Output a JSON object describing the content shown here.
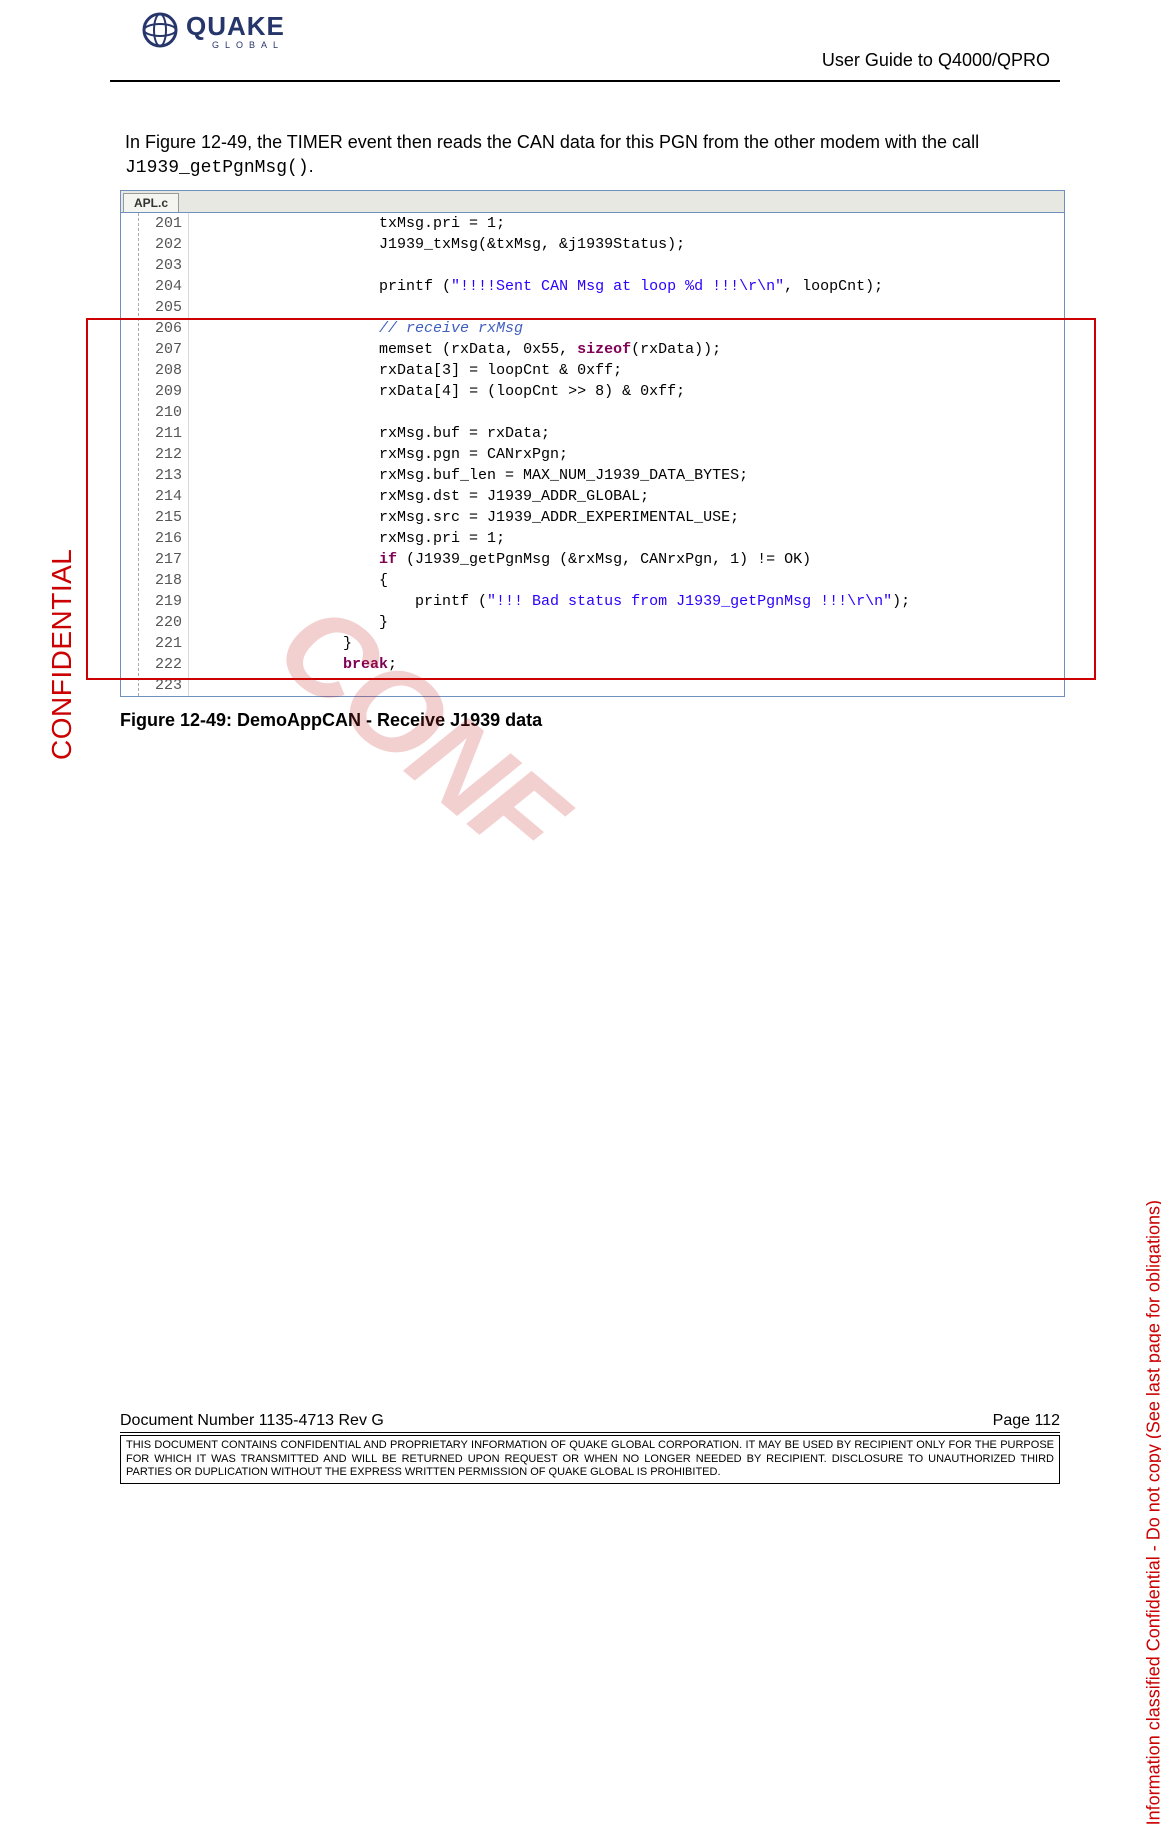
{
  "header": {
    "brand_main": "QUAKE",
    "brand_sub": "GLOBAL",
    "doc_title": "User Guide to Q4000/QPRO"
  },
  "body": {
    "para_pre": "In Figure 12-49, the TIMER event then reads the CAN data for this PGN from the other modem with the call ",
    "para_code": "J1939_getPgnMsg()",
    "para_post": "."
  },
  "code": {
    "tab": "APL.c",
    "lines": [
      {
        "n": "201",
        "indent": "                    ",
        "tokens": [
          [
            "txMsg.pri = ",
            ""
          ],
          [
            "1",
            "numlit"
          ],
          [
            ";",
            ""
          ]
        ]
      },
      {
        "n": "202",
        "indent": "                    ",
        "tokens": [
          [
            "J1939_txMsg(&txMsg, &j1939Status);",
            ""
          ]
        ]
      },
      {
        "n": "203",
        "indent": "",
        "tokens": [
          [
            "",
            ""
          ]
        ]
      },
      {
        "n": "204",
        "indent": "                    ",
        "tokens": [
          [
            "printf (",
            ""
          ],
          [
            "\"!!!!Sent CAN Msg at loop %d !!!\\r\\n\"",
            "str"
          ],
          [
            ", loopCnt);",
            ""
          ]
        ]
      },
      {
        "n": "205",
        "indent": "",
        "tokens": [
          [
            "",
            ""
          ]
        ]
      },
      {
        "n": "206",
        "indent": "                    ",
        "tokens": [
          [
            "// receive rxMsg",
            "cmt"
          ]
        ]
      },
      {
        "n": "207",
        "indent": "                    ",
        "tokens": [
          [
            "memset (rxData, ",
            ""
          ],
          [
            "0x55",
            "hexlit"
          ],
          [
            ", ",
            ""
          ],
          [
            "sizeof",
            "kw"
          ],
          [
            "(rxData));",
            ""
          ]
        ]
      },
      {
        "n": "208",
        "indent": "                    ",
        "tokens": [
          [
            "rxData[",
            ""
          ],
          [
            "3",
            "numlit"
          ],
          [
            "] = loopCnt & ",
            ""
          ],
          [
            "0xff",
            "hexlit"
          ],
          [
            ";",
            ""
          ]
        ]
      },
      {
        "n": "209",
        "indent": "                    ",
        "tokens": [
          [
            "rxData[",
            ""
          ],
          [
            "4",
            "numlit"
          ],
          [
            "] = (loopCnt >> ",
            ""
          ],
          [
            "8",
            "numlit"
          ],
          [
            ") & ",
            ""
          ],
          [
            "0xff",
            "hexlit"
          ],
          [
            ";",
            ""
          ]
        ]
      },
      {
        "n": "210",
        "indent": "",
        "tokens": [
          [
            "",
            ""
          ]
        ]
      },
      {
        "n": "211",
        "indent": "                    ",
        "tokens": [
          [
            "rxMsg.buf = rxData;",
            ""
          ]
        ]
      },
      {
        "n": "212",
        "indent": "                    ",
        "tokens": [
          [
            "rxMsg.pgn = CANrxPgn;",
            ""
          ]
        ]
      },
      {
        "n": "213",
        "indent": "                    ",
        "tokens": [
          [
            "rxMsg.buf_len = MAX_NUM_J1939_DATA_BYTES;",
            ""
          ]
        ]
      },
      {
        "n": "214",
        "indent": "                    ",
        "tokens": [
          [
            "rxMsg.dst = J1939_ADDR_GLOBAL;",
            ""
          ]
        ]
      },
      {
        "n": "215",
        "indent": "                    ",
        "tokens": [
          [
            "rxMsg.src = J1939_ADDR_EXPERIMENTAL_USE;",
            ""
          ]
        ]
      },
      {
        "n": "216",
        "indent": "                    ",
        "tokens": [
          [
            "rxMsg.pri = ",
            ""
          ],
          [
            "1",
            "numlit"
          ],
          [
            ";",
            ""
          ]
        ]
      },
      {
        "n": "217",
        "indent": "                    ",
        "tokens": [
          [
            "if",
            "kw"
          ],
          [
            " (J1939_getPgnMsg (&rxMsg, CANrxPgn, ",
            ""
          ],
          [
            "1",
            "numlit"
          ],
          [
            ") != OK)",
            ""
          ]
        ]
      },
      {
        "n": "218",
        "indent": "                    ",
        "tokens": [
          [
            "{",
            ""
          ]
        ]
      },
      {
        "n": "219",
        "indent": "                        ",
        "tokens": [
          [
            "printf (",
            ""
          ],
          [
            "\"!!! Bad status from J1939_getPgnMsg !!!\\r\\n\"",
            "str"
          ],
          [
            ");",
            ""
          ]
        ]
      },
      {
        "n": "220",
        "indent": "                    ",
        "tokens": [
          [
            "}",
            ""
          ]
        ]
      },
      {
        "n": "221",
        "indent": "                ",
        "tokens": [
          [
            "}",
            ""
          ]
        ]
      },
      {
        "n": "222",
        "indent": "                ",
        "tokens": [
          [
            "break",
            "kw"
          ],
          [
            ";",
            ""
          ]
        ]
      },
      {
        "n": "223",
        "indent": "",
        "tokens": [
          [
            "",
            ""
          ]
        ]
      }
    ]
  },
  "figure_caption": "Figure 12-49:  DemoAppCAN - Receive J1939 data",
  "sidemarks": {
    "left": "CONFIDENTIAL",
    "right": "Information classified Confidential - Do not copy (See last page for obligations)"
  },
  "footer": {
    "doc_number": "Document Number 1135-4713   Rev G",
    "page": "Page 112",
    "notice": "THIS DOCUMENT CONTAINS CONFIDENTIAL AND PROPRIETARY INFORMATION OF QUAKE GLOBAL CORPORATION.  IT MAY BE USED BY RECIPIENT ONLY FOR THE PURPOSE FOR WHICH IT WAS TRANSMITTED AND WILL BE RETURNED UPON REQUEST OR WHEN NO LONGER NEEDED BY RECIPIENT.  DISCLOSURE TO UNAUTHORIZED THIRD PARTIES OR DUPLICATION WITHOUT THE EXPRESS WRITTEN PERMISSION OF QUAKE GLOBAL IS PROHIBITED."
  }
}
